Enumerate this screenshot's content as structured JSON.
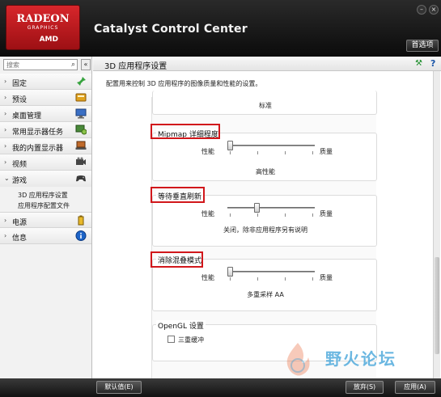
{
  "header": {
    "logo_line1": "RADEON",
    "logo_line2": "GRAPHICS",
    "logo_line3": "AMD",
    "app_title": "Catalyst Control Center",
    "minimize_glyph": "–",
    "close_glyph": "×",
    "preferences_label": "首选项"
  },
  "sidebar": {
    "search_placeholder": "搜索",
    "collapse_glyph": "«",
    "items": [
      {
        "label": "固定",
        "icon": "pin-icon"
      },
      {
        "label": "预设",
        "icon": "preset-icon"
      },
      {
        "label": "桌面管理",
        "icon": "desktop-icon"
      },
      {
        "label": "常用显示器任务",
        "icon": "monitor-tasks-icon"
      },
      {
        "label": "我的内置显示器",
        "icon": "laptop-icon"
      },
      {
        "label": "视频",
        "icon": "video-icon"
      },
      {
        "label": "游戏",
        "icon": "gamepad-icon"
      },
      {
        "label": "电源",
        "icon": "battery-icon"
      },
      {
        "label": "信息",
        "icon": "info-icon"
      }
    ],
    "sub_items": [
      "3D 应用程序设置",
      "应用程序配置文件"
    ]
  },
  "main": {
    "title": "3D 应用程序设置",
    "description": "配置用来控制 3D 应用程序的图像质量和性能的设置。",
    "partial_value": "标准",
    "groups": [
      {
        "title": "Mipmap 详细程度",
        "left": "性能",
        "right": "质量",
        "value": "高性能",
        "level": 0.0
      },
      {
        "title": "等待垂直刷新",
        "left": "性能",
        "right": "质量",
        "value": "关闭，除非应用程序另有说明",
        "level": 0.33
      },
      {
        "title": "消除混叠模式",
        "left": "性能",
        "right": "质量",
        "value": "多重采样 AA",
        "level": 0.0
      }
    ],
    "opengl": {
      "title": "OpenGL 设置",
      "checkbox_label": "三重缓冲",
      "checked": false
    }
  },
  "footer": {
    "defaults_label": "默认值(E)",
    "discard_label": "放弃(S)",
    "apply_label": "应用(A)"
  },
  "watermark": {
    "text": "野火论坛"
  },
  "colors": {
    "accent_red": "#d1171b",
    "header_bg": "#1a1a1a",
    "watermark_blue": "#3aa0d8"
  }
}
